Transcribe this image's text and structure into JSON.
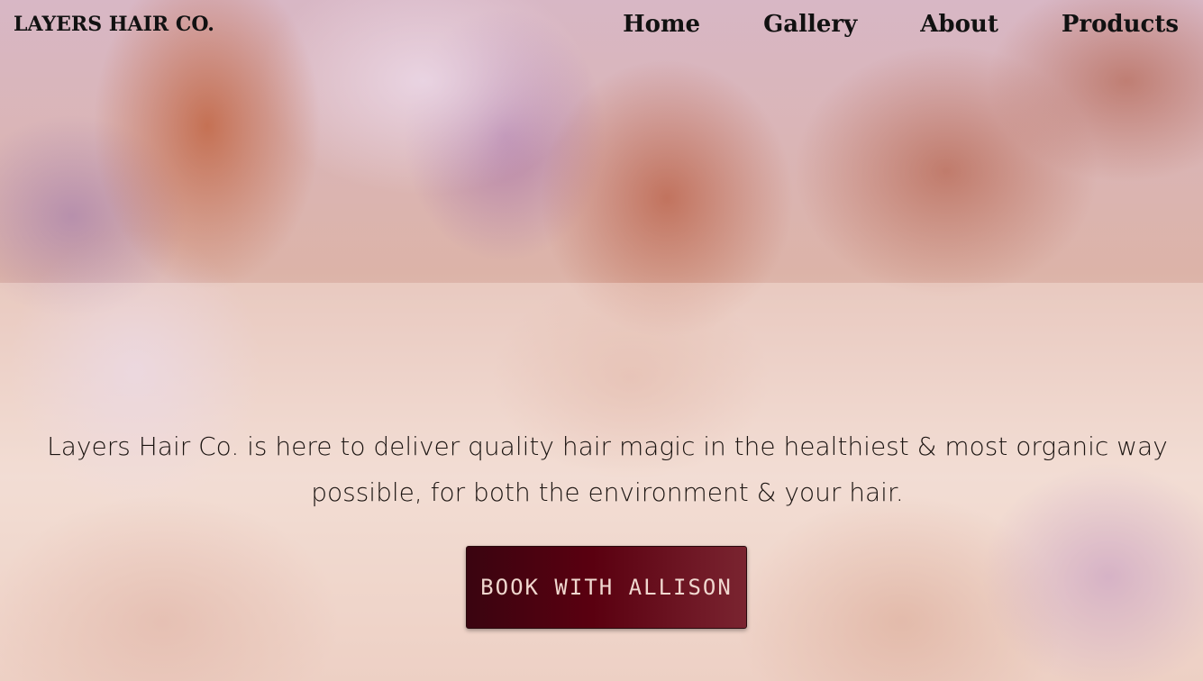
{
  "header": {
    "brand": "LAYERS HAIR CO.",
    "nav": [
      {
        "label": "Home"
      },
      {
        "label": "Gallery"
      },
      {
        "label": "About"
      },
      {
        "label": "Products"
      }
    ]
  },
  "hero": {
    "tagline": "Layers Hair Co. is here to deliver quality hair magic in the healthiest & most organic way possible, for both the environment & your hair.",
    "cta_label": "BOOK WITH ALLISON"
  },
  "colors": {
    "cta_start": "#3a0410",
    "cta_end": "#7a2430",
    "cta_text": "#f0d7cf",
    "text": "#111111"
  }
}
